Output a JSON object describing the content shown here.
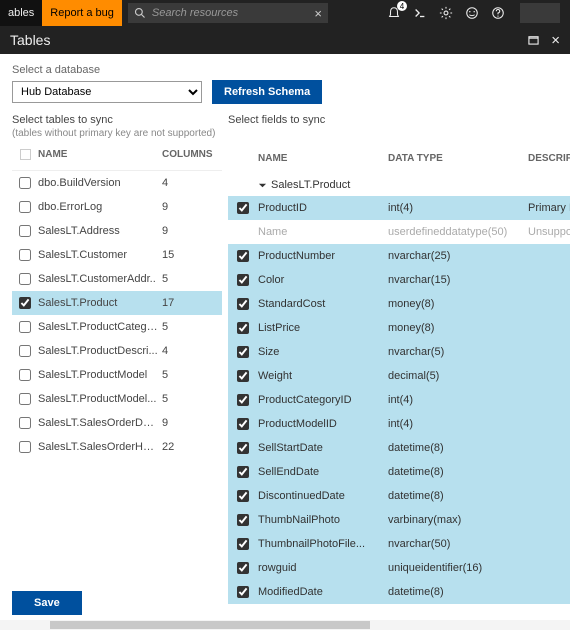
{
  "topbar": {
    "tab_tables": "ables",
    "tab_bug": "Report a bug",
    "search_placeholder": "Search resources",
    "notif_count": "4"
  },
  "title": "Tables",
  "db": {
    "label": "Select a database",
    "selected": "Hub Database",
    "refresh": "Refresh Schema"
  },
  "left": {
    "label": "Select tables to sync",
    "sub": "(tables without primary key are not supported)",
    "head_name": "NAME",
    "head_cols": "COLUMNS",
    "rows": [
      {
        "name": "dbo.BuildVersion",
        "cols": "4",
        "chk": false,
        "sel": false
      },
      {
        "name": "dbo.ErrorLog",
        "cols": "9",
        "chk": false,
        "sel": false
      },
      {
        "name": "SalesLT.Address",
        "cols": "9",
        "chk": false,
        "sel": false
      },
      {
        "name": "SalesLT.Customer",
        "cols": "15",
        "chk": false,
        "sel": false
      },
      {
        "name": "SalesLT.CustomerAddr..",
        "cols": "5",
        "chk": false,
        "sel": false
      },
      {
        "name": "SalesLT.Product",
        "cols": "17",
        "chk": true,
        "sel": true
      },
      {
        "name": "SalesLT.ProductCatego..",
        "cols": "5",
        "chk": false,
        "sel": false
      },
      {
        "name": "SalesLT.ProductDescri...",
        "cols": "4",
        "chk": false,
        "sel": false
      },
      {
        "name": "SalesLT.ProductModel",
        "cols": "5",
        "chk": false,
        "sel": false
      },
      {
        "name": "SalesLT.ProductModel...",
        "cols": "5",
        "chk": false,
        "sel": false
      },
      {
        "name": "SalesLT.SalesOrderDet...",
        "cols": "9",
        "chk": false,
        "sel": false
      },
      {
        "name": "SalesLT.SalesOrderHea...",
        "cols": "22",
        "chk": false,
        "sel": false
      }
    ]
  },
  "right": {
    "label": "Select fields to sync",
    "head_name": "NAME",
    "head_type": "DATA TYPE",
    "head_desc": "DESCRIPTIONS",
    "group": "SalesLT.Product",
    "rows": [
      {
        "name": "ProductID",
        "type": "int(4)",
        "desc": "Primary Key",
        "chk": true,
        "sel": true,
        "dis": false
      },
      {
        "name": "Name",
        "type": "userdefineddatatype(50)",
        "desc": "Unsupported",
        "chk": false,
        "sel": false,
        "dis": true
      },
      {
        "name": "ProductNumber",
        "type": "nvarchar(25)",
        "desc": "",
        "chk": true,
        "sel": true,
        "dis": false
      },
      {
        "name": "Color",
        "type": "nvarchar(15)",
        "desc": "",
        "chk": true,
        "sel": true,
        "dis": false
      },
      {
        "name": "StandardCost",
        "type": "money(8)",
        "desc": "",
        "chk": true,
        "sel": true,
        "dis": false
      },
      {
        "name": "ListPrice",
        "type": "money(8)",
        "desc": "",
        "chk": true,
        "sel": true,
        "dis": false
      },
      {
        "name": "Size",
        "type": "nvarchar(5)",
        "desc": "",
        "chk": true,
        "sel": true,
        "dis": false
      },
      {
        "name": "Weight",
        "type": "decimal(5)",
        "desc": "",
        "chk": true,
        "sel": true,
        "dis": false
      },
      {
        "name": "ProductCategoryID",
        "type": "int(4)",
        "desc": "",
        "chk": true,
        "sel": true,
        "dis": false
      },
      {
        "name": "ProductModelID",
        "type": "int(4)",
        "desc": "",
        "chk": true,
        "sel": true,
        "dis": false
      },
      {
        "name": "SellStartDate",
        "type": "datetime(8)",
        "desc": "",
        "chk": true,
        "sel": true,
        "dis": false
      },
      {
        "name": "SellEndDate",
        "type": "datetime(8)",
        "desc": "",
        "chk": true,
        "sel": true,
        "dis": false
      },
      {
        "name": "DiscontinuedDate",
        "type": "datetime(8)",
        "desc": "",
        "chk": true,
        "sel": true,
        "dis": false
      },
      {
        "name": "ThumbNailPhoto",
        "type": "varbinary(max)",
        "desc": "",
        "chk": true,
        "sel": true,
        "dis": false
      },
      {
        "name": "ThumbnailPhotoFile...",
        "type": "nvarchar(50)",
        "desc": "",
        "chk": true,
        "sel": true,
        "dis": false
      },
      {
        "name": "rowguid",
        "type": "uniqueidentifier(16)",
        "desc": "",
        "chk": true,
        "sel": true,
        "dis": false
      },
      {
        "name": "ModifiedDate",
        "type": "datetime(8)",
        "desc": "",
        "chk": true,
        "sel": true,
        "dis": false
      }
    ]
  },
  "footer": {
    "save": "Save"
  }
}
